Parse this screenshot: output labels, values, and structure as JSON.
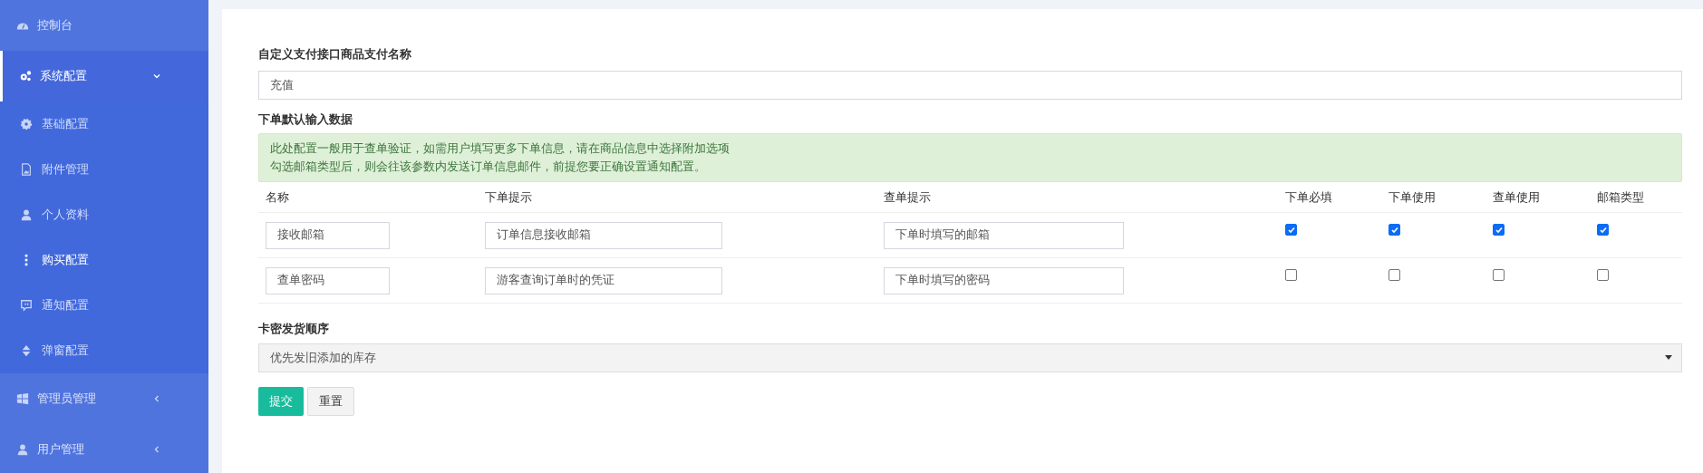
{
  "sidebar": {
    "items": [
      {
        "label": "控制台",
        "selected": false
      },
      {
        "label": "系统配置",
        "selected": true,
        "expanded": true,
        "children": [
          {
            "label": "基础配置",
            "selected": false
          },
          {
            "label": "附件管理",
            "selected": false
          },
          {
            "label": "个人资料",
            "selected": false
          },
          {
            "label": "购买配置",
            "selected": true
          },
          {
            "label": "通知配置",
            "selected": false
          },
          {
            "label": "弹窗配置",
            "selected": false
          }
        ]
      },
      {
        "label": "管理员管理",
        "selected": false,
        "expanded": false
      },
      {
        "label": "用户管理",
        "selected": false,
        "expanded": false
      }
    ]
  },
  "form": {
    "pay_name": {
      "label": "自定义支付接口商品支付名称",
      "value": "充值"
    },
    "order_input": {
      "label": "下单默认输入数据",
      "notice": [
        "此处配置一般用于查单验证，如需用户填写更多下单信息，请在商品信息中选择附加选项",
        "勾选邮箱类型后，则会往该参数内发送订单信息邮件，前提您要正确设置通知配置。"
      ],
      "columns": [
        "名称",
        "下单提示",
        "查单提示",
        "下单必填",
        "下单使用",
        "查单使用",
        "邮箱类型"
      ],
      "rows": [
        {
          "fields": [
            {
              "value": "接收邮箱"
            },
            {
              "value": "订单信息接收邮箱"
            },
            {
              "value": "下单时填写的邮箱"
            }
          ],
          "required": true,
          "order_use": true,
          "query_use": true,
          "email_type": true
        },
        {
          "fields": [
            {
              "value": "查单密码"
            },
            {
              "value": "游客查询订单时的凭证"
            },
            {
              "value": "下单时填写的密码"
            }
          ],
          "required": false,
          "order_use": false,
          "query_use": false,
          "email_type": false
        }
      ]
    },
    "card_order": {
      "label": "卡密发货顺序",
      "value": "优先发旧添加的库存"
    },
    "buttons": [
      {
        "label": "提交",
        "kind": "primary"
      },
      {
        "label": "重置",
        "kind": "default"
      }
    ]
  }
}
